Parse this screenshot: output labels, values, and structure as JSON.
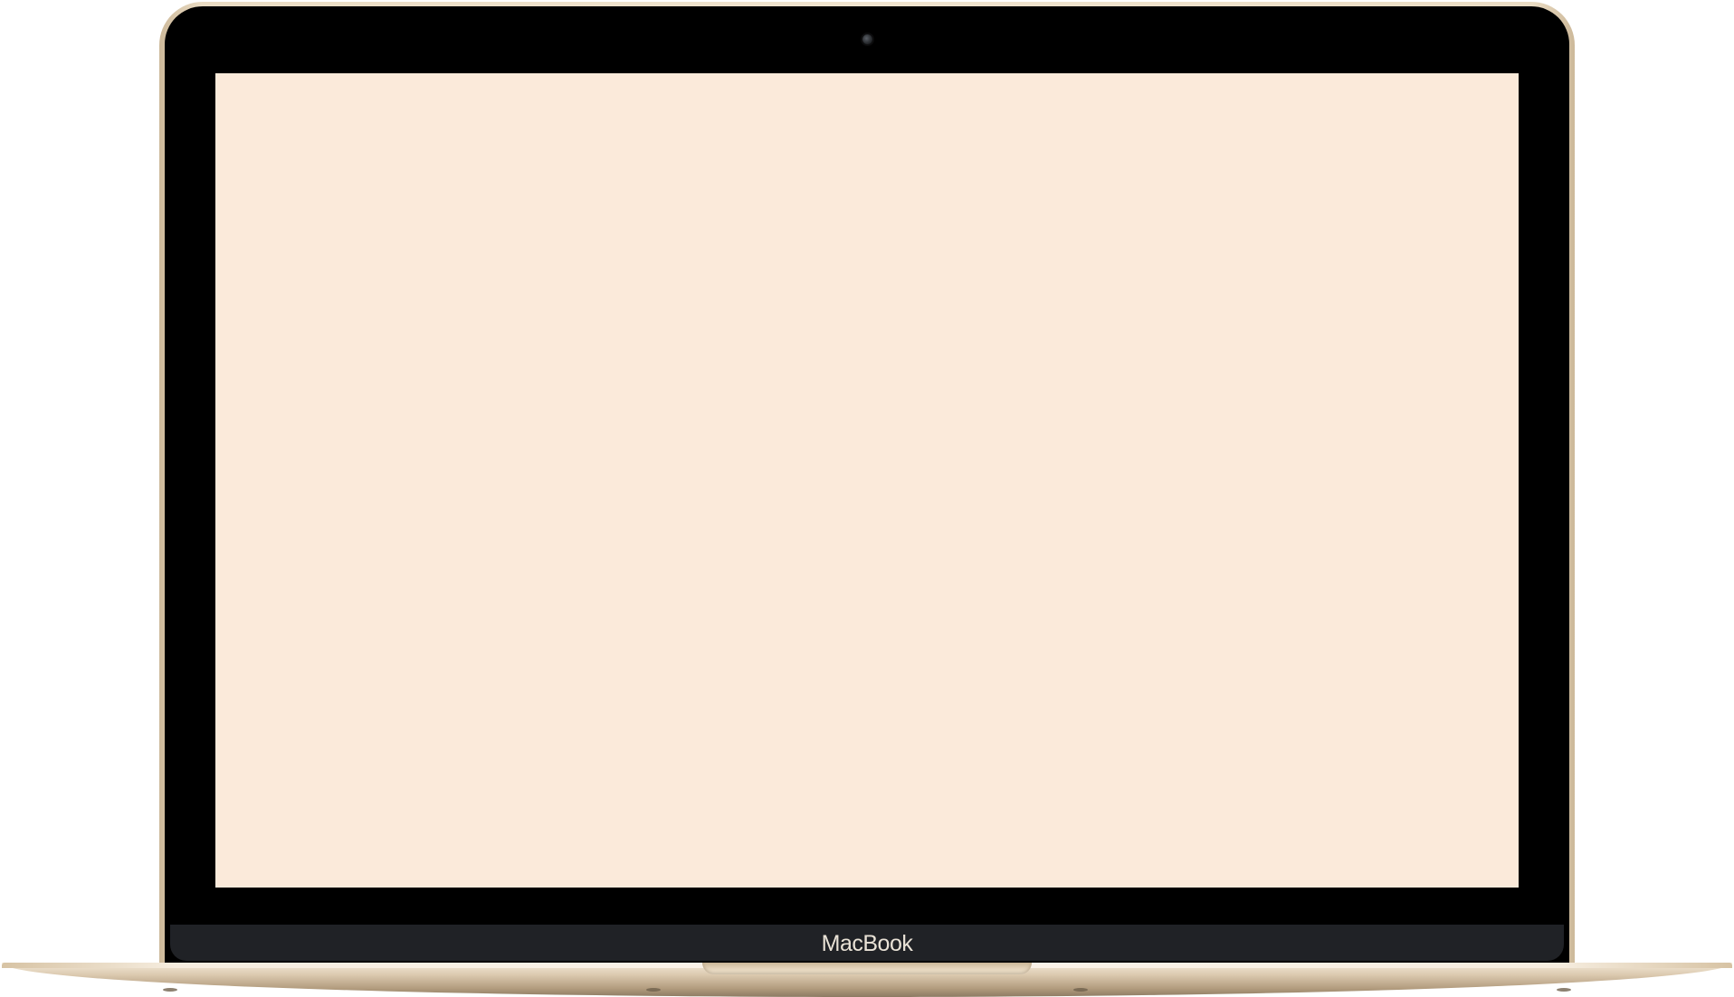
{
  "device": {
    "brand_label": "MacBook",
    "screen_color": "#fbeada",
    "bezel_color": "#000000",
    "body_color": "#e8d8bf"
  }
}
